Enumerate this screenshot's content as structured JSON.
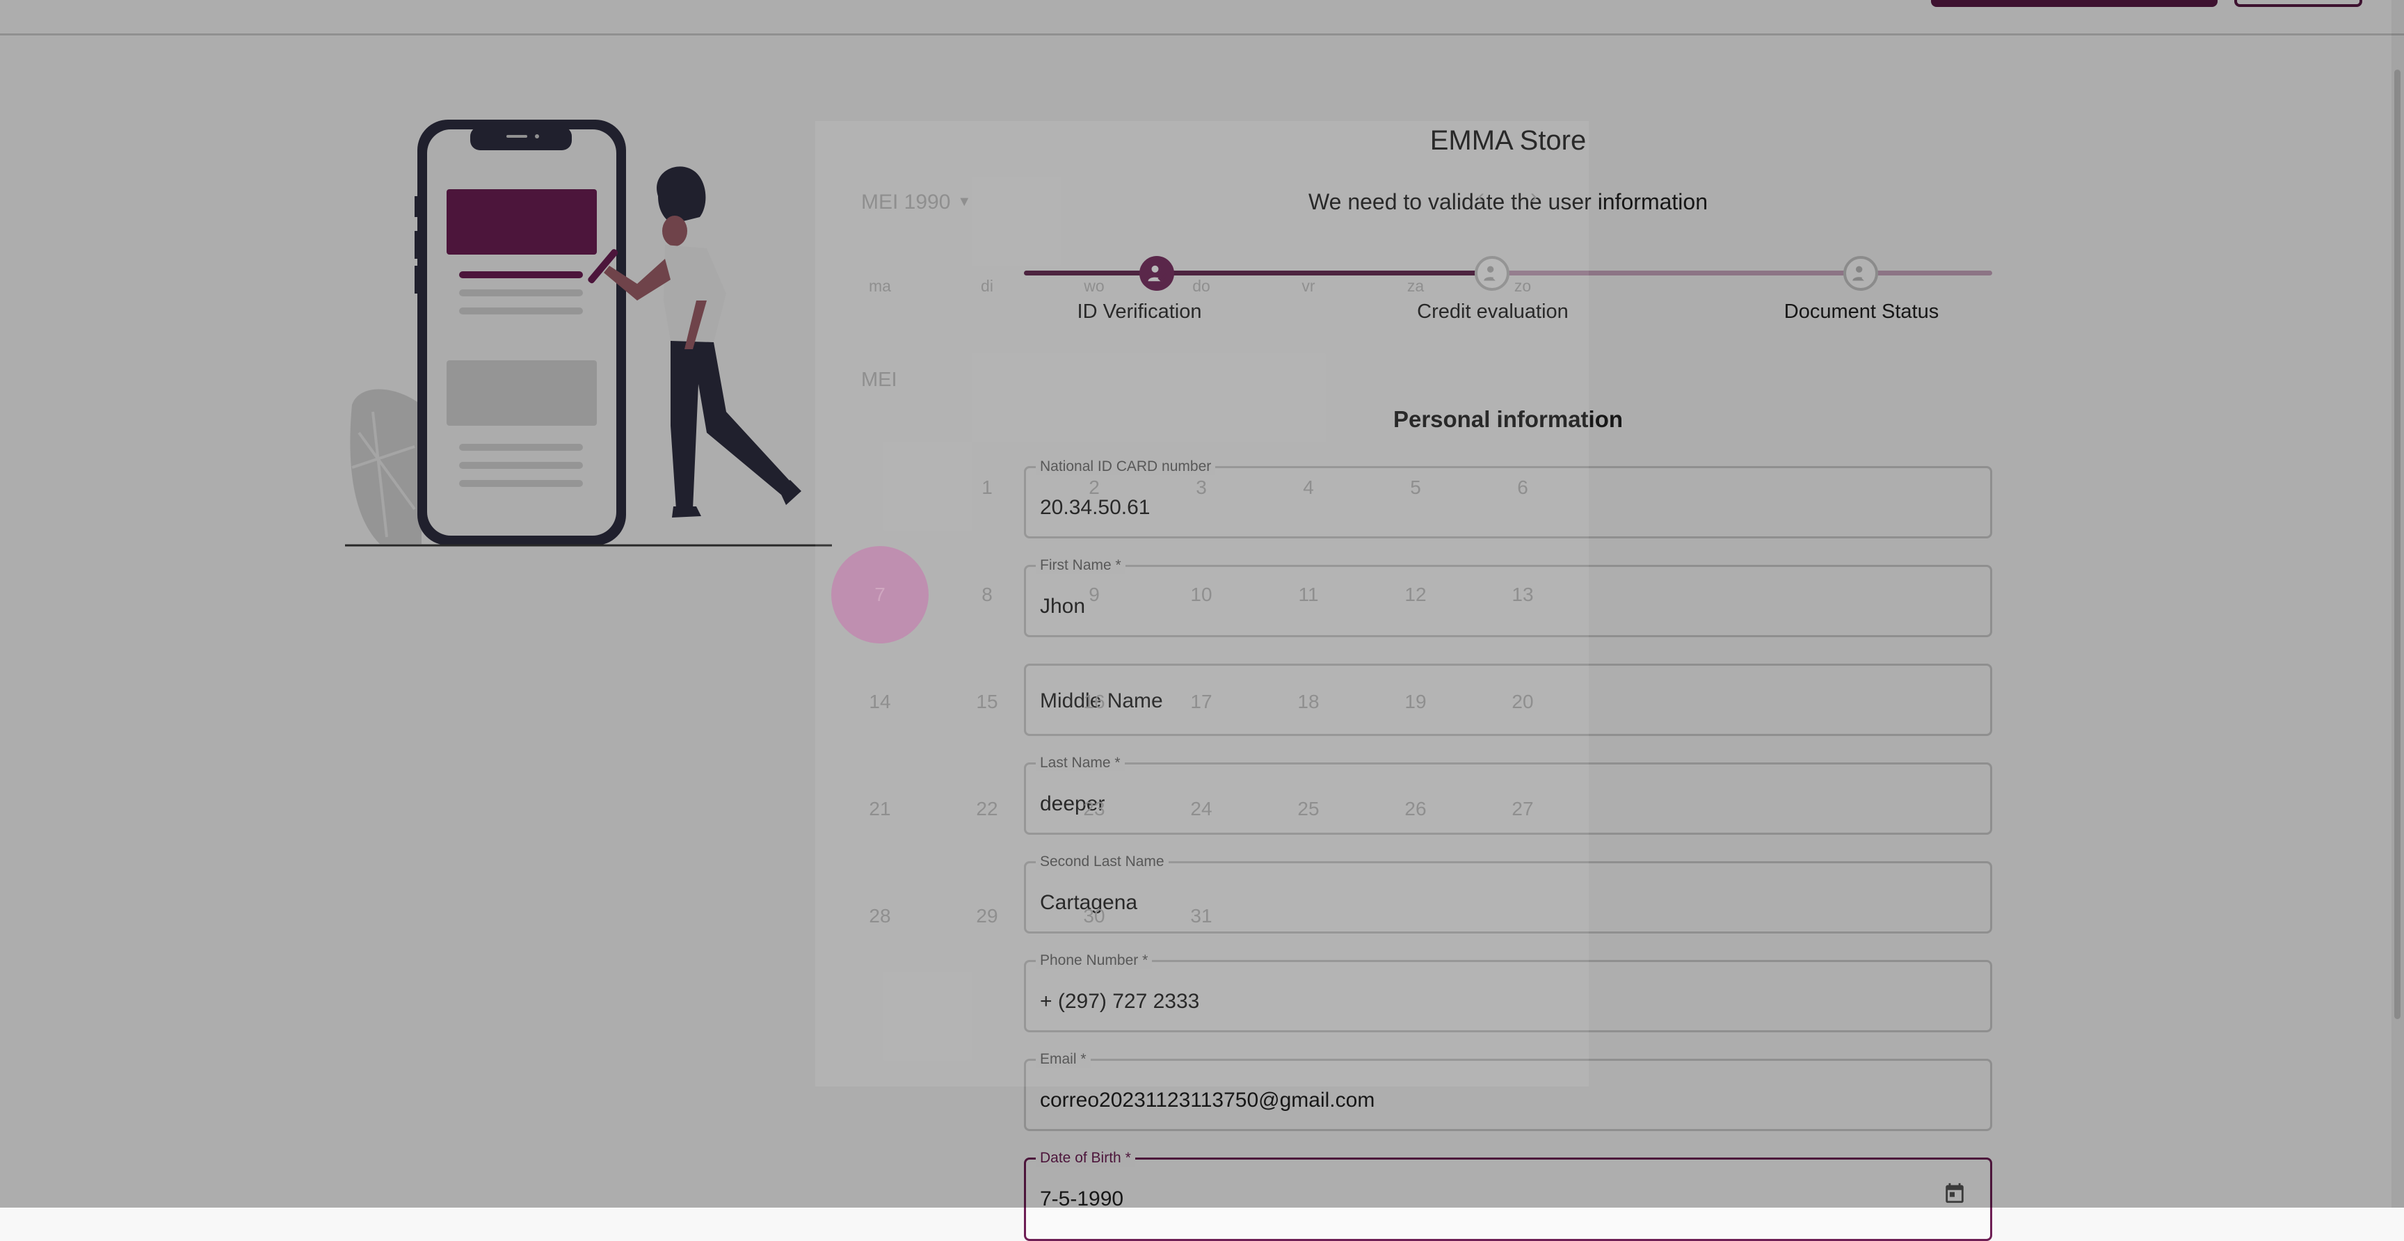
{
  "app": {
    "brand": "EMMA Store",
    "subtitle": "We need to validate the user information"
  },
  "stepper": {
    "steps": [
      {
        "label": "ID Verification",
        "state": "active"
      },
      {
        "label": "Credit evaluation",
        "state": "inactive"
      },
      {
        "label": "Document Status",
        "state": "inactive"
      }
    ]
  },
  "form": {
    "section_title": "Personal information",
    "fields": [
      {
        "label": "National ID CARD number",
        "value": "20.34.50.61"
      },
      {
        "label": "First Name",
        "required": "*",
        "value": "Jhon"
      },
      {
        "placeholder": "Middle Name"
      },
      {
        "label": "Last Name",
        "required": "*",
        "value": "deeper"
      },
      {
        "label": "Second Last Name",
        "value": "Cartagena"
      },
      {
        "label": "Phone Number",
        "required": "*",
        "value": "+ (297) 727 2333"
      },
      {
        "label": "Email",
        "required": "*",
        "value": "correo20231123113750@gmail.com"
      },
      {
        "label": "Date of Birth",
        "required": "*",
        "value": "7-5-1990"
      }
    ]
  },
  "datepicker": {
    "header": "MEI 1990",
    "nav_prev": "‹",
    "nav_next": "›",
    "month_label": "MEI",
    "weekdays": [
      "ma",
      "di",
      "wo",
      "do",
      "vr",
      "za",
      "zo"
    ],
    "selected_day": "7",
    "days": [
      "1",
      "2",
      "3",
      "4",
      "5",
      "6",
      "7",
      "8",
      "9",
      "10",
      "11",
      "12",
      "13",
      "14",
      "15",
      "16",
      "17",
      "18",
      "19",
      "20",
      "21",
      "22",
      "23",
      "24",
      "25",
      "26",
      "27",
      "28",
      "29",
      "30",
      "31"
    ]
  },
  "colors": {
    "brand": "#6e1f55",
    "brand_light": "#c9a7bf",
    "overlay": "rgba(0,0,0,0.30)"
  },
  "icons": {
    "calendar": "calendar-icon",
    "step_check": "user-check-icon"
  }
}
